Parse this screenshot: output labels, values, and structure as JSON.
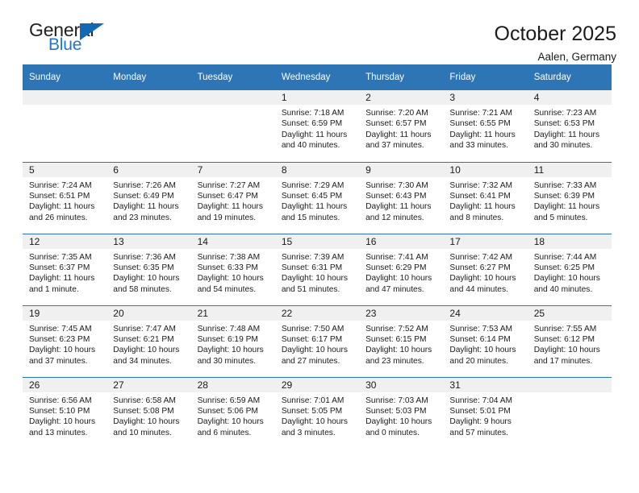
{
  "brand": {
    "name_top": "General",
    "name_bottom": "Blue",
    "triangle_color": "#1468b3",
    "blue_text_color": "#2277c8"
  },
  "header": {
    "title": "October 2025",
    "subtitle": "Aalen, Germany"
  },
  "theme": {
    "header_blue": "#2e75b6",
    "daynum_strip": "#f0f0f0",
    "text": "#1a1a1a"
  },
  "calendar": {
    "weekday_headers": [
      "Sunday",
      "Monday",
      "Tuesday",
      "Wednesday",
      "Thursday",
      "Friday",
      "Saturday"
    ],
    "weeks": [
      [
        {
          "day": "",
          "empty": true
        },
        {
          "day": "",
          "empty": true
        },
        {
          "day": "",
          "empty": true
        },
        {
          "day": "1",
          "sunrise": "Sunrise: 7:18 AM",
          "sunset": "Sunset: 6:59 PM",
          "daylight": "Daylight: 11 hours and 40 minutes."
        },
        {
          "day": "2",
          "sunrise": "Sunrise: 7:20 AM",
          "sunset": "Sunset: 6:57 PM",
          "daylight": "Daylight: 11 hours and 37 minutes."
        },
        {
          "day": "3",
          "sunrise": "Sunrise: 7:21 AM",
          "sunset": "Sunset: 6:55 PM",
          "daylight": "Daylight: 11 hours and 33 minutes."
        },
        {
          "day": "4",
          "sunrise": "Sunrise: 7:23 AM",
          "sunset": "Sunset: 6:53 PM",
          "daylight": "Daylight: 11 hours and 30 minutes."
        }
      ],
      [
        {
          "day": "5",
          "sunrise": "Sunrise: 7:24 AM",
          "sunset": "Sunset: 6:51 PM",
          "daylight": "Daylight: 11 hours and 26 minutes."
        },
        {
          "day": "6",
          "sunrise": "Sunrise: 7:26 AM",
          "sunset": "Sunset: 6:49 PM",
          "daylight": "Daylight: 11 hours and 23 minutes."
        },
        {
          "day": "7",
          "sunrise": "Sunrise: 7:27 AM",
          "sunset": "Sunset: 6:47 PM",
          "daylight": "Daylight: 11 hours and 19 minutes."
        },
        {
          "day": "8",
          "sunrise": "Sunrise: 7:29 AM",
          "sunset": "Sunset: 6:45 PM",
          "daylight": "Daylight: 11 hours and 15 minutes."
        },
        {
          "day": "9",
          "sunrise": "Sunrise: 7:30 AM",
          "sunset": "Sunset: 6:43 PM",
          "daylight": "Daylight: 11 hours and 12 minutes."
        },
        {
          "day": "10",
          "sunrise": "Sunrise: 7:32 AM",
          "sunset": "Sunset: 6:41 PM",
          "daylight": "Daylight: 11 hours and 8 minutes."
        },
        {
          "day": "11",
          "sunrise": "Sunrise: 7:33 AM",
          "sunset": "Sunset: 6:39 PM",
          "daylight": "Daylight: 11 hours and 5 minutes."
        }
      ],
      [
        {
          "day": "12",
          "sunrise": "Sunrise: 7:35 AM",
          "sunset": "Sunset: 6:37 PM",
          "daylight": "Daylight: 11 hours and 1 minute."
        },
        {
          "day": "13",
          "sunrise": "Sunrise: 7:36 AM",
          "sunset": "Sunset: 6:35 PM",
          "daylight": "Daylight: 10 hours and 58 minutes."
        },
        {
          "day": "14",
          "sunrise": "Sunrise: 7:38 AM",
          "sunset": "Sunset: 6:33 PM",
          "daylight": "Daylight: 10 hours and 54 minutes."
        },
        {
          "day": "15",
          "sunrise": "Sunrise: 7:39 AM",
          "sunset": "Sunset: 6:31 PM",
          "daylight": "Daylight: 10 hours and 51 minutes."
        },
        {
          "day": "16",
          "sunrise": "Sunrise: 7:41 AM",
          "sunset": "Sunset: 6:29 PM",
          "daylight": "Daylight: 10 hours and 47 minutes."
        },
        {
          "day": "17",
          "sunrise": "Sunrise: 7:42 AM",
          "sunset": "Sunset: 6:27 PM",
          "daylight": "Daylight: 10 hours and 44 minutes."
        },
        {
          "day": "18",
          "sunrise": "Sunrise: 7:44 AM",
          "sunset": "Sunset: 6:25 PM",
          "daylight": "Daylight: 10 hours and 40 minutes."
        }
      ],
      [
        {
          "day": "19",
          "sunrise": "Sunrise: 7:45 AM",
          "sunset": "Sunset: 6:23 PM",
          "daylight": "Daylight: 10 hours and 37 minutes."
        },
        {
          "day": "20",
          "sunrise": "Sunrise: 7:47 AM",
          "sunset": "Sunset: 6:21 PM",
          "daylight": "Daylight: 10 hours and 34 minutes."
        },
        {
          "day": "21",
          "sunrise": "Sunrise: 7:48 AM",
          "sunset": "Sunset: 6:19 PM",
          "daylight": "Daylight: 10 hours and 30 minutes."
        },
        {
          "day": "22",
          "sunrise": "Sunrise: 7:50 AM",
          "sunset": "Sunset: 6:17 PM",
          "daylight": "Daylight: 10 hours and 27 minutes."
        },
        {
          "day": "23",
          "sunrise": "Sunrise: 7:52 AM",
          "sunset": "Sunset: 6:15 PM",
          "daylight": "Daylight: 10 hours and 23 minutes."
        },
        {
          "day": "24",
          "sunrise": "Sunrise: 7:53 AM",
          "sunset": "Sunset: 6:14 PM",
          "daylight": "Daylight: 10 hours and 20 minutes."
        },
        {
          "day": "25",
          "sunrise": "Sunrise: 7:55 AM",
          "sunset": "Sunset: 6:12 PM",
          "daylight": "Daylight: 10 hours and 17 minutes."
        }
      ],
      [
        {
          "day": "26",
          "sunrise": "Sunrise: 6:56 AM",
          "sunset": "Sunset: 5:10 PM",
          "daylight": "Daylight: 10 hours and 13 minutes."
        },
        {
          "day": "27",
          "sunrise": "Sunrise: 6:58 AM",
          "sunset": "Sunset: 5:08 PM",
          "daylight": "Daylight: 10 hours and 10 minutes."
        },
        {
          "day": "28",
          "sunrise": "Sunrise: 6:59 AM",
          "sunset": "Sunset: 5:06 PM",
          "daylight": "Daylight: 10 hours and 6 minutes."
        },
        {
          "day": "29",
          "sunrise": "Sunrise: 7:01 AM",
          "sunset": "Sunset: 5:05 PM",
          "daylight": "Daylight: 10 hours and 3 minutes."
        },
        {
          "day": "30",
          "sunrise": "Sunrise: 7:03 AM",
          "sunset": "Sunset: 5:03 PM",
          "daylight": "Daylight: 10 hours and 0 minutes."
        },
        {
          "day": "31",
          "sunrise": "Sunrise: 7:04 AM",
          "sunset": "Sunset: 5:01 PM",
          "daylight": "Daylight: 9 hours and 57 minutes."
        },
        {
          "day": "",
          "empty": true
        }
      ]
    ]
  }
}
